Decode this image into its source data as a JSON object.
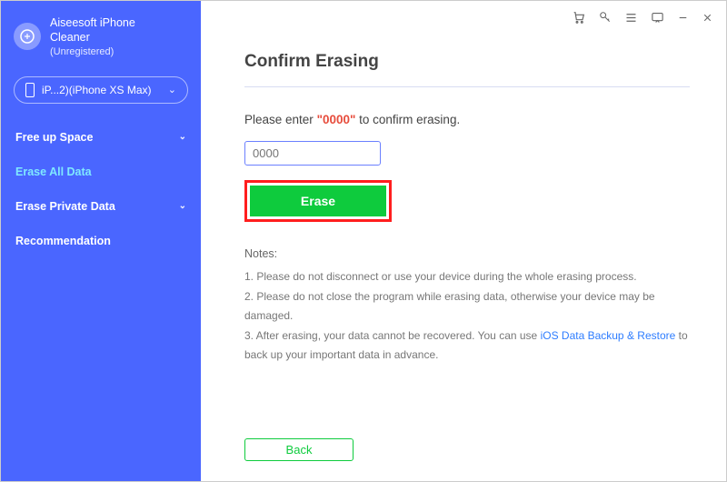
{
  "brand": {
    "title_line1": "Aiseesoft iPhone",
    "title_line2": "Cleaner",
    "status": "(Unregistered)"
  },
  "device": {
    "label": "iP...2)(iPhone XS Max)"
  },
  "nav": {
    "free_up": "Free up Space",
    "erase_all": "Erase All Data",
    "erase_private": "Erase Private Data",
    "recommendation": "Recommendation"
  },
  "main": {
    "heading": "Confirm Erasing",
    "prompt_before": "Please enter ",
    "prompt_code": "\"0000\"",
    "prompt_after": " to confirm erasing.",
    "input_placeholder": "0000",
    "erase_label": "Erase",
    "notes_title": "Notes:",
    "note1": "1. Please do not disconnect or use your device during the whole erasing process.",
    "note2": "2. Please do not close the program while erasing data, otherwise your device may be damaged.",
    "note3a": "3. After erasing, your data cannot be recovered. You can use ",
    "note3_link": "iOS Data Backup & Restore",
    "note3b": " to back up your important data in advance.",
    "back_label": "Back"
  },
  "colors": {
    "sidebar": "#4a66ff",
    "accent_green": "#0ecb3d",
    "highlight_red": "#ff1e1e",
    "code_red": "#e74c3c",
    "link_blue": "#2e7dff"
  }
}
